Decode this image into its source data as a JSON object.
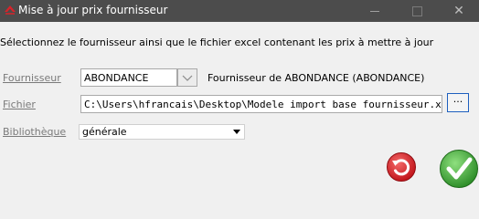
{
  "window": {
    "title": "Mise à jour prix fournisseur"
  },
  "form": {
    "instruction": "Sélectionnez le fournisseur ainsi que le fichier excel contenant les prix à mettre à jour",
    "fournisseur": {
      "label": "Fournisseur",
      "value": "ABONDANCE",
      "description": "Fournisseur de ABONDANCE (ABONDANCE)"
    },
    "fichier": {
      "label": "Fichier",
      "value": "C:\\Users\\hfrancais\\Desktop\\Modele import base fournisseur.xlsx",
      "browse_label": "..."
    },
    "bibliotheque": {
      "label": "Bibliothèque",
      "selected": "générale"
    }
  },
  "colors": {
    "titlebar": "#4c4c4c",
    "cancel": "#d9262b",
    "ok": "#3fa63a"
  }
}
